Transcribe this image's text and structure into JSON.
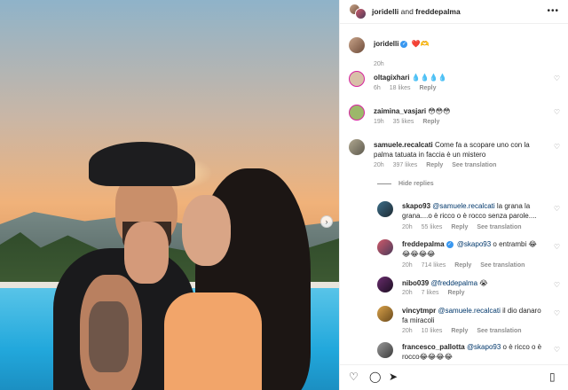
{
  "header": {
    "user1": "joridelli",
    "joiner": "and",
    "user2": "freddepalma",
    "more": "•••"
  },
  "caption": {
    "username": "joridelli",
    "text": "❤️🫶",
    "time": "20h"
  },
  "comments": [
    {
      "username": "oltagixhari",
      "text": "💧💧💧💧",
      "time": "6h",
      "likes": "18 likes",
      "reply": "Reply"
    },
    {
      "username": "zaimina_vasjari",
      "text": "😳😳😳",
      "time": "19h",
      "likes": "35 likes",
      "reply": "Reply"
    },
    {
      "username": "samuele.recalcati",
      "text": "Come fa a scopare uno con la palma tatuata in faccia è un mistero",
      "time": "20h",
      "likes": "397 likes",
      "reply": "Reply",
      "translation": "See translation"
    }
  ],
  "hide_replies": "Hide replies",
  "replies": [
    {
      "username": "skapo93",
      "mention": "@samuele.recalcati",
      "text": "la grana la grana....o è ricco o è rocco senza parole....",
      "time": "20h",
      "likes": "55 likes",
      "reply": "Reply",
      "translation": "See translation"
    },
    {
      "username": "freddepalma",
      "mention": "@skapo93",
      "text": "o entrambi 😂😂😂😂😂",
      "time": "20h",
      "likes": "714 likes",
      "reply": "Reply",
      "translation": "See translation",
      "verified": true
    },
    {
      "username": "nibo039",
      "mention": "@freddepalma",
      "text": "😭",
      "time": "20h",
      "likes": "7 likes",
      "reply": "Reply"
    },
    {
      "username": "vincytmpr",
      "mention": "@samuele.recalcati",
      "text": "il dio danaro fa miracoli",
      "time": "20h",
      "likes": "10 likes",
      "reply": "Reply",
      "translation": "See translation"
    },
    {
      "username": "francesco_pallotta",
      "mention": "@skapo93",
      "text": "o è ricco o è rocco😂😂😂😂",
      "time": "",
      "likes": "",
      "reply": ""
    }
  ],
  "icons": {
    "like": "heart-icon",
    "comment": "comment-icon",
    "share": "send-icon",
    "save": "bookmark-icon"
  }
}
